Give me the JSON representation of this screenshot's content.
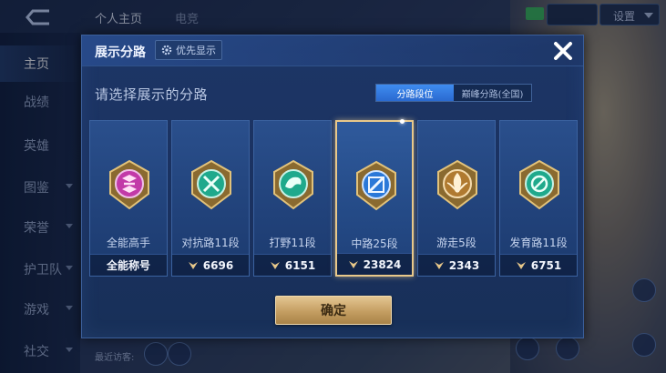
{
  "topbar": {
    "tabs": [
      "个人主页",
      "电竞"
    ],
    "select_value": "设置"
  },
  "sidebar": {
    "items": [
      {
        "label": "主页",
        "active": true,
        "has_arrow": false
      },
      {
        "label": "战绩",
        "active": false,
        "has_arrow": false
      },
      {
        "label": "英雄",
        "active": false,
        "has_arrow": false
      },
      {
        "label": "图鉴",
        "active": false,
        "has_arrow": true
      },
      {
        "label": "荣誉",
        "active": false,
        "has_arrow": true
      },
      {
        "label": "护卫队",
        "active": false,
        "has_arrow": true
      },
      {
        "label": "游戏",
        "active": false,
        "has_arrow": true
      },
      {
        "label": "社交",
        "active": false,
        "has_arrow": true
      }
    ],
    "visitor_text": "最近访客:"
  },
  "modal": {
    "title": "展示分路",
    "priority_label": "优先显示",
    "prompt": "请选择展示的分路",
    "toggle": [
      {
        "label": "分路段位",
        "active": true
      },
      {
        "label": "巅峰分路(全国)",
        "active": false
      }
    ],
    "cards": [
      {
        "name": "全能高手",
        "bottom": "全能称号",
        "has_icon": false,
        "badge_color": "#c23aa8",
        "selected": false
      },
      {
        "name": "对抗路11段",
        "bottom": "6696",
        "has_icon": true,
        "badge_color": "#1fa98c",
        "selected": false
      },
      {
        "name": "打野11段",
        "bottom": "6151",
        "has_icon": true,
        "badge_color": "#1fa98c",
        "selected": false
      },
      {
        "name": "中路25段",
        "bottom": "23824",
        "has_icon": true,
        "badge_color": "#2a78d8",
        "selected": true
      },
      {
        "name": "游走5段",
        "bottom": "2343",
        "has_icon": true,
        "badge_color": "#b07a30",
        "selected": false
      },
      {
        "name": "发育路11段",
        "bottom": "6751",
        "has_icon": true,
        "badge_color": "#1fa98c",
        "selected": false
      }
    ],
    "confirm_label": "确定"
  },
  "colors": {
    "accent_gold": "#e8c88a",
    "toggle_active": "#3f8cf0",
    "panel_bg": "#1d3666"
  },
  "icons": [
    "back-icon",
    "gear-icon",
    "close-icon",
    "lane-score-icon",
    "chevron-down-icon"
  ]
}
